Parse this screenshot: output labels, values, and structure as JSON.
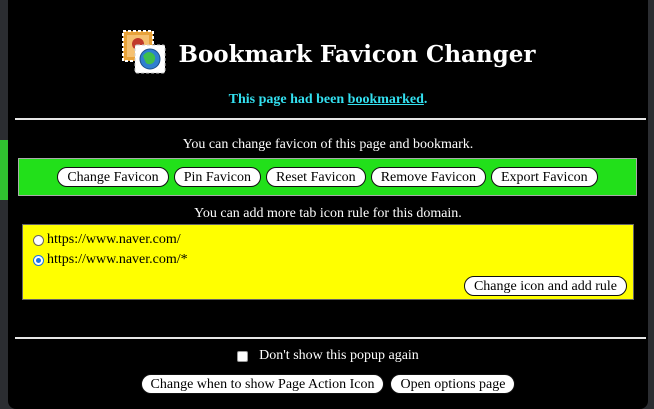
{
  "popup": {
    "title": "Bookmark Favicon Changer",
    "status_prefix": "This page had been ",
    "status_link": "bookmarked",
    "status_suffix": "."
  },
  "favicon_section": {
    "info": "You can change favicon of this page and bookmark.",
    "buttons": [
      {
        "label": "Change Favicon"
      },
      {
        "label": "Pin Favicon"
      },
      {
        "label": "Reset Favicon"
      },
      {
        "label": "Remove Favicon"
      },
      {
        "label": "Export Favicon"
      }
    ]
  },
  "rule_section": {
    "info": "You can add more tab icon rule for this domain.",
    "options": [
      {
        "label": "https://www.naver.com/",
        "checked": false
      },
      {
        "label": "https://www.naver.com/*",
        "checked": true
      }
    ],
    "add_rule_label": "Change icon and add rule"
  },
  "footer": {
    "checkbox_label": "Don't show this popup again",
    "checkbox_checked": false,
    "page_action_label": "Change when to show Page Action Icon",
    "options_label": "Open options page"
  },
  "colors": {
    "status": "#33e0f0",
    "green_box": "#22e01a",
    "yellow_box": "#ffff00",
    "radio_accent": "#1a73e8"
  }
}
